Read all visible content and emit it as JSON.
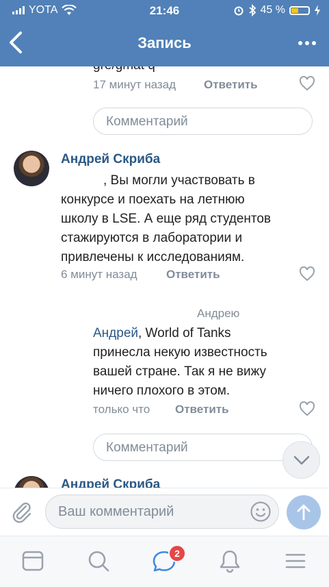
{
  "status_bar": {
    "carrier": "YOTA",
    "time": "21:46",
    "battery": "45 %"
  },
  "nav": {
    "title": "Запись"
  },
  "comments": {
    "prev_cut_text": "gre/gmat q",
    "prev_time": "17 минут назад",
    "reply_label": "Ответить",
    "comment_placeholder": "Комментарий",
    "c1": {
      "author": "Андрей Скриба",
      "text_prefix": ", Вы могли участвовать в",
      "lines": [
        "конкурсе и поехать на летнюю",
        "школу в LSE. А еще ряд студентов",
        "стажируются в лаборатории и",
        "привлечены к исследованиям."
      ],
      "time": "6 минут назад"
    },
    "c2": {
      "reply_to": "Андрею",
      "mention": "Андрей",
      "text_first": ", World of Tanks",
      "lines": [
        "принесла некую известность",
        "вашей стране. Так я не вижу",
        "ничего плохого в этом."
      ],
      "time": "только что"
    },
    "c3": {
      "author": "Андрей Скриба"
    }
  },
  "composer": {
    "placeholder": "Ваш комментарий"
  },
  "tabbar": {
    "badge_count": "2"
  },
  "colors": {
    "brand": "#5181b8",
    "link": "#2a5885",
    "muted": "#818c99",
    "badge": "#e64646"
  }
}
